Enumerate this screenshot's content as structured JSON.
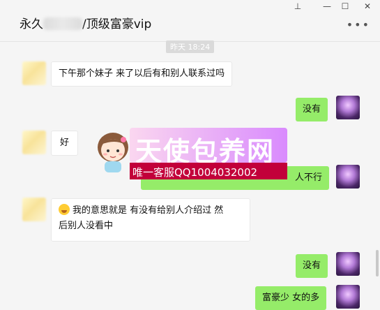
{
  "window": {
    "title_prefix": "永久",
    "title_suffix": "/顶级富豪vip",
    "pin_glyph": "⊥",
    "minimize_glyph": "—",
    "maximize_glyph": "☐",
    "close_glyph": "✕",
    "more_glyph": "•••"
  },
  "chat": {
    "timestamp": "昨天 18:24",
    "messages": [
      {
        "side": "left",
        "text": "下午那个妹子 来了以后有和别人联系过吗"
      },
      {
        "side": "right",
        "text": "没有"
      },
      {
        "side": "left",
        "text": "好"
      },
      {
        "side": "right",
        "text": "人不行"
      },
      {
        "side": "left",
        "line1": "我的意思就是  有没有给别人介绍过 然",
        "line2": "后别人没看中"
      },
      {
        "side": "right",
        "text": "没有"
      },
      {
        "side": "right",
        "text": "富豪少 女的多"
      }
    ]
  },
  "watermark": {
    "title": "天使包养网",
    "contact": "唯一客服QQ1004032002"
  },
  "colors": {
    "sent_bubble": "#95ec69",
    "received_bubble": "#ffffff",
    "background": "#f5f5f5",
    "watermark_strip": "#c2003a"
  }
}
